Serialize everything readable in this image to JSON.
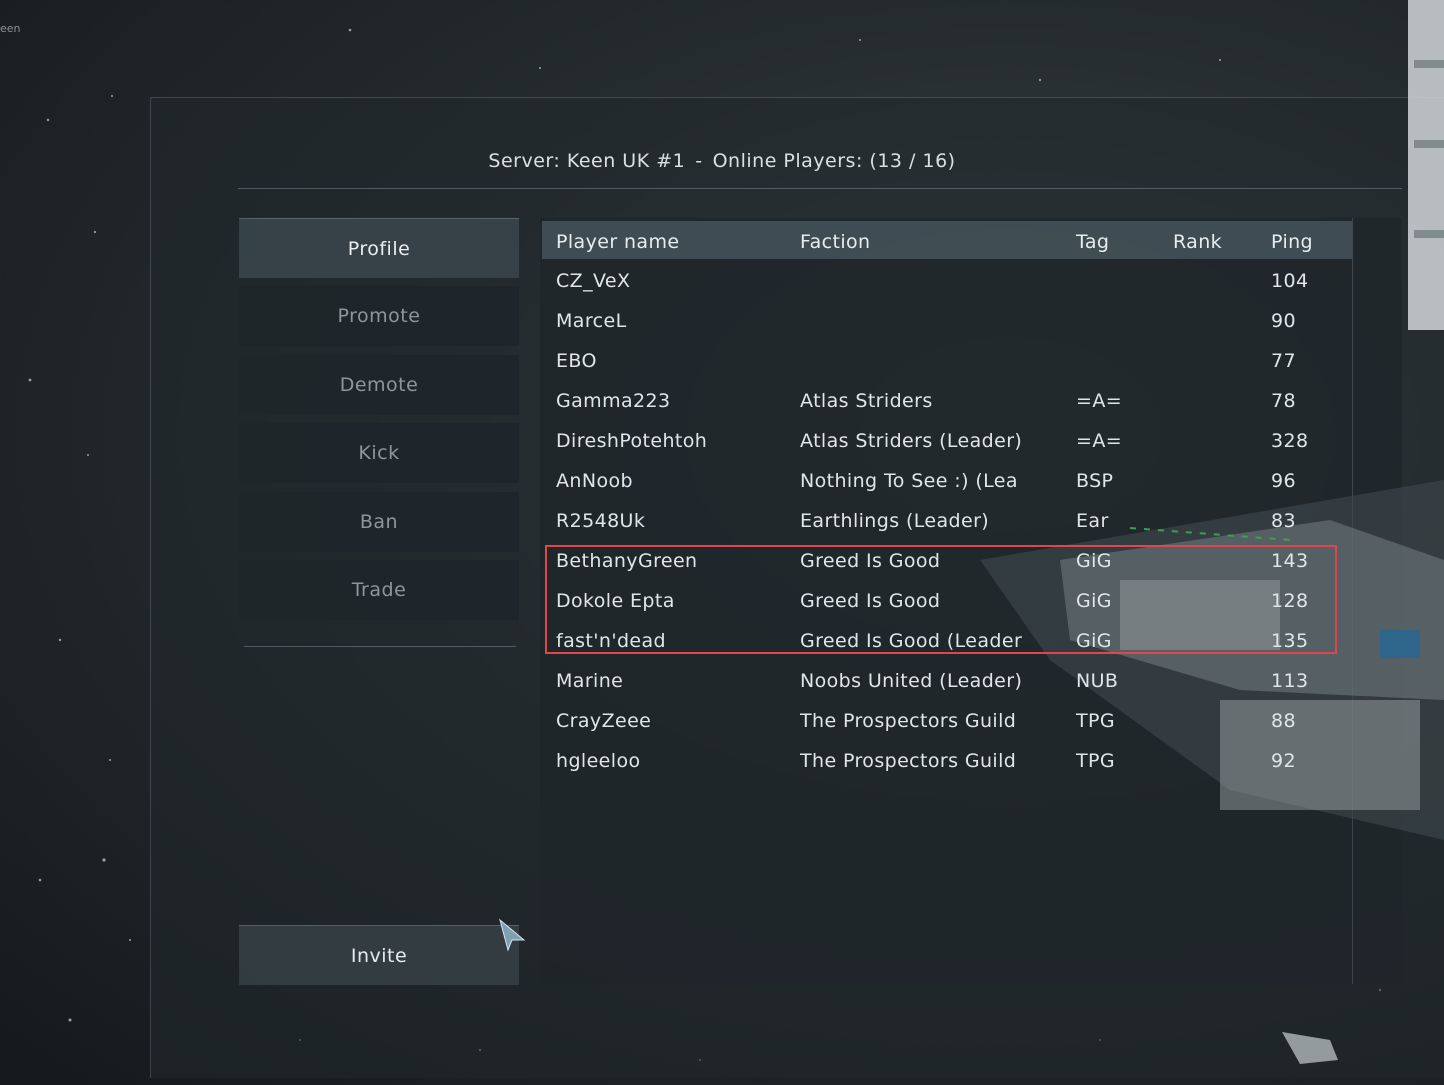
{
  "corner_text": "een",
  "header": {
    "server_label": "Server: Keen UK #1",
    "separator": "-",
    "players_label": "Online Players:",
    "players_count": "(13 / 16)"
  },
  "sidebar": {
    "buttons": [
      {
        "label": "Profile",
        "state": "active"
      },
      {
        "label": "Promote",
        "state": "inactive"
      },
      {
        "label": "Demote",
        "state": "inactive"
      },
      {
        "label": "Kick",
        "state": "inactive"
      },
      {
        "label": "Ban",
        "state": "inactive"
      },
      {
        "label": "Trade",
        "state": "inactive"
      }
    ],
    "invite_label": "Invite"
  },
  "table": {
    "columns": [
      "Player name",
      "Faction",
      "Tag",
      "Rank",
      "Ping"
    ],
    "rows": [
      {
        "name": "CZ_VeX",
        "faction": "",
        "tag": "",
        "rank": "",
        "ping": "104"
      },
      {
        "name": "MarceL",
        "faction": "",
        "tag": "",
        "rank": "",
        "ping": "90"
      },
      {
        "name": "EBO",
        "faction": "",
        "tag": "",
        "rank": "",
        "ping": "77"
      },
      {
        "name": "Gamma223",
        "faction": "Atlas Striders",
        "tag": "=A=",
        "rank": "",
        "ping": "78"
      },
      {
        "name": "DireshPotehtoh",
        "faction": "Atlas Striders (Leader)",
        "tag": "=A=",
        "rank": "",
        "ping": "328"
      },
      {
        "name": "AnNoob",
        "faction": "Nothing To See :) (Lea",
        "tag": "BSP",
        "rank": "",
        "ping": "96"
      },
      {
        "name": "R2548Uk",
        "faction": "Earthlings (Leader)",
        "tag": "Ear",
        "rank": "",
        "ping": "83"
      },
      {
        "name": "BethanyGreen",
        "faction": "Greed Is Good",
        "tag": "GiG",
        "rank": "",
        "ping": "143"
      },
      {
        "name": "Dokole Epta",
        "faction": "Greed Is Good",
        "tag": "GiG",
        "rank": "",
        "ping": "128"
      },
      {
        "name": "fast'n'dead",
        "faction": "Greed Is Good (Leader",
        "tag": "GiG",
        "rank": "",
        "ping": "135"
      },
      {
        "name": "Marine",
        "faction": "Noobs United (Leader)",
        "tag": "NUB",
        "rank": "",
        "ping": "113"
      },
      {
        "name": "CrayZeee",
        "faction": "The Prospectors Guild",
        "tag": "TPG",
        "rank": "",
        "ping": "88"
      },
      {
        "name": "hgleeloo",
        "faction": "The Prospectors Guild",
        "tag": "TPG",
        "rank": "",
        "ping": "92"
      }
    ]
  },
  "colors": {
    "highlight": "#e0464a",
    "panel": "#1e262a",
    "header_row": "#46545a"
  }
}
